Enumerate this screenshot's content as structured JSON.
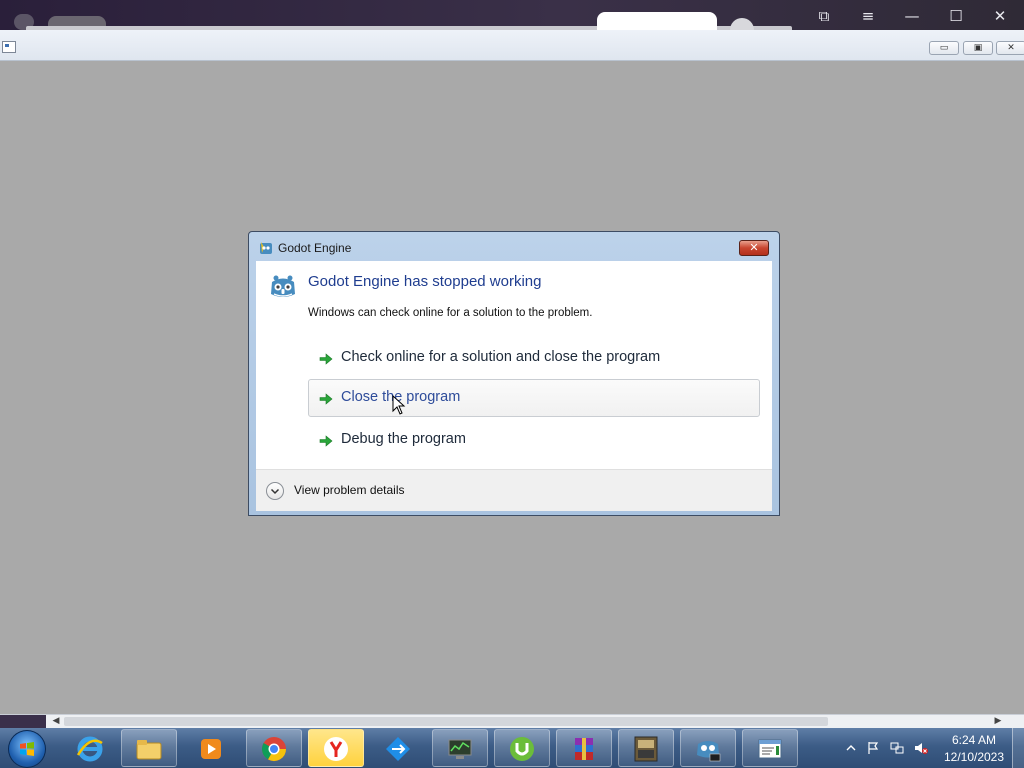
{
  "host": {
    "controls": [
      "⧉",
      "≡",
      "—",
      "☐",
      "✕"
    ]
  },
  "viewer": {
    "buttons": [
      "▭",
      "▣",
      "✕"
    ]
  },
  "dialog": {
    "title": "Godot Engine",
    "close_label": "✕",
    "headline": "Godot Engine has stopped working",
    "description": "Windows can check online for a solution to the problem.",
    "options": [
      {
        "label": "Check online for a solution and close the program"
      },
      {
        "label": "Close the program"
      },
      {
        "label": "Debug the program"
      }
    ],
    "details_label": "View problem details",
    "accent": "#1f3d8f"
  },
  "scrollbar": {
    "left_arrow": "◀",
    "right_arrow": "▶"
  },
  "taskbar": {
    "apps": [
      "internet-explorer-icon",
      "file-explorer-icon",
      "media-player-icon",
      "chrome-icon",
      "yandex-icon",
      "teamviewer-icon",
      "network-monitor-icon",
      "utorrent-icon",
      "winrar-icon",
      "game-icon",
      "godot-console-icon",
      "notepad-window-icon"
    ],
    "clock_time": "6:24 AM",
    "clock_date": "12/10/2023"
  }
}
